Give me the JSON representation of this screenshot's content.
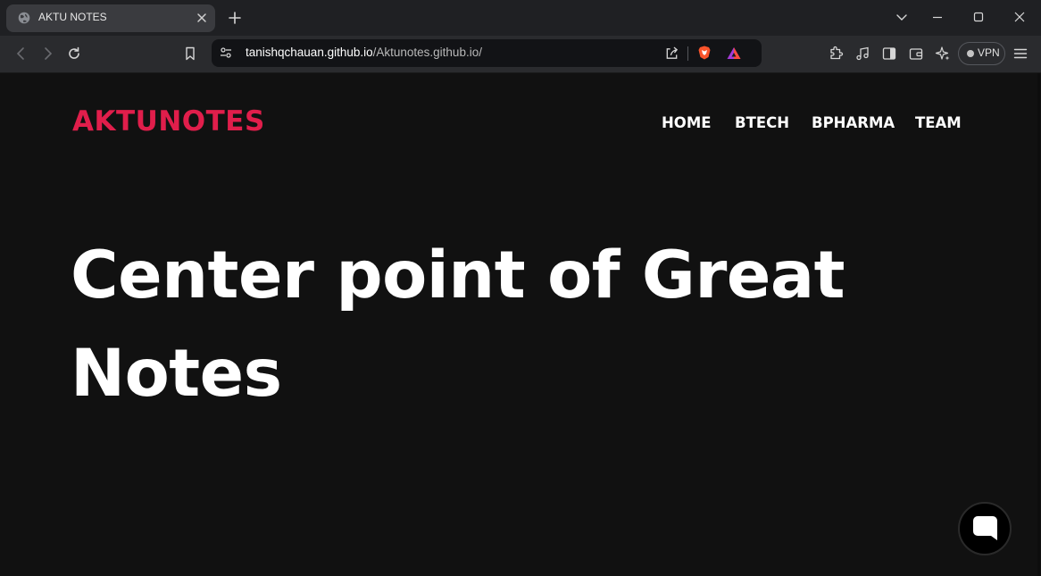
{
  "browser": {
    "tab": {
      "title": "AKTU NOTES",
      "favicon": "globe-icon"
    },
    "new_tab_icon": "plus-icon",
    "address": {
      "host": "tanishqchauan.github.io",
      "path": "/Aktunotes.github.io/"
    },
    "vpn_label": "VPN"
  },
  "site": {
    "brand": "AKTUNOTES",
    "brand_color": "#e01e4b",
    "nav": [
      "HOME",
      "BTECH",
      "BPHARMA",
      "TEAM"
    ],
    "hero_line1": "Center point of Great",
    "hero_line2": "Notes",
    "chat_icon": "chat-bubble-icon"
  }
}
